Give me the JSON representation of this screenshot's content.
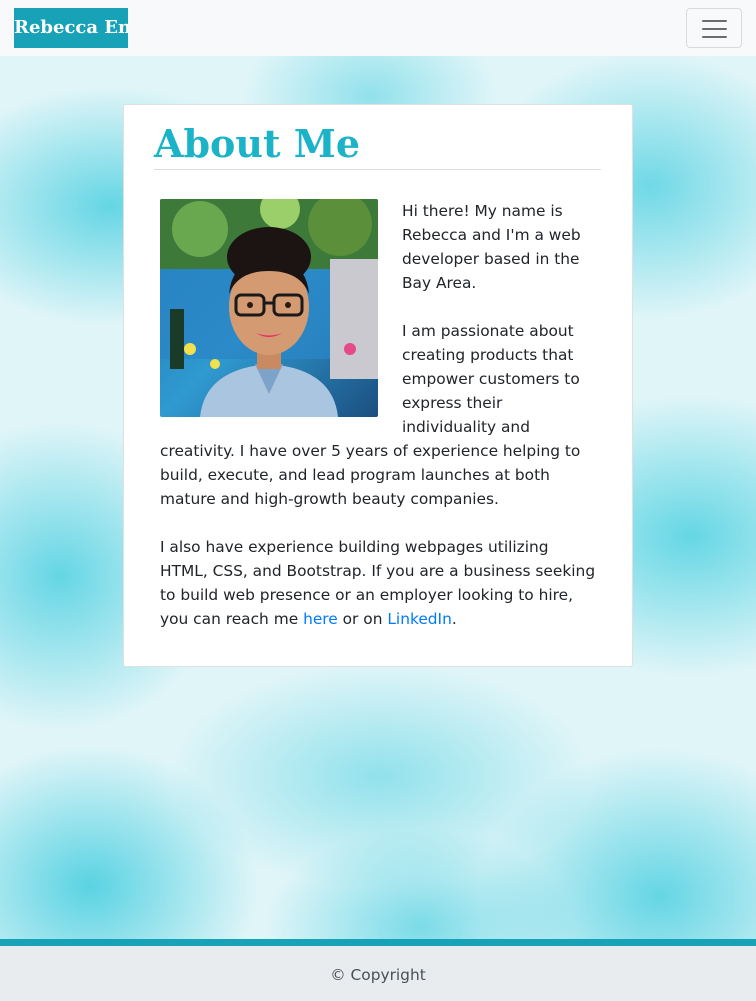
{
  "navbar": {
    "brand": "Rebecca Eng",
    "menu_icon": "hamburger-menu-icon"
  },
  "about": {
    "title": "About Me",
    "photo_alt": "profile-photo",
    "paragraph1": "Hi there! My name is Rebecca and I'm a web developer based in the Bay Area.",
    "paragraph2": "I am passionate about creating products that empower customers to express their individuality and creativity. I have over 5 years of experience helping to build, execute, and lead program launches at both mature and high-growth beauty companies.",
    "paragraph3_before": "I also have experience building webpages utilizing HTML, CSS, and Bootstrap. If you are a business seeking to build web presence or an employer looking to hire, you can reach me ",
    "link_here": "here",
    "paragraph3_middle": " or on ",
    "link_linkedin": "LinkedIn",
    "paragraph3_end": "."
  },
  "footer": {
    "copyright": "© Copyright"
  },
  "colors": {
    "brand_bg": "#17a2b8",
    "title": "#1bb3c7",
    "link": "#007bff",
    "footer_bg": "#e9ecef"
  }
}
